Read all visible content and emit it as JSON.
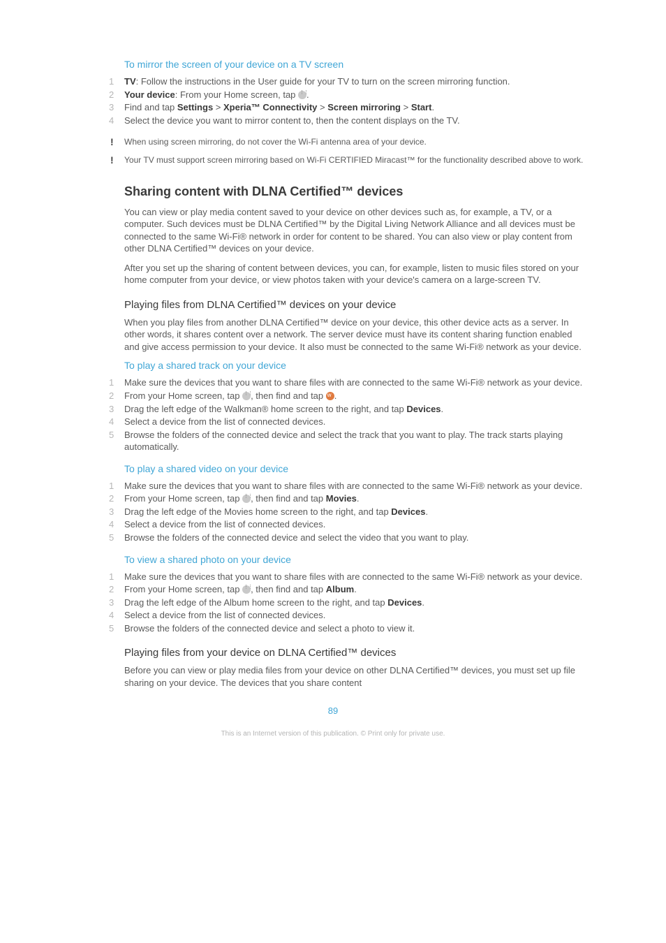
{
  "proc_mirror": {
    "title": "To mirror the screen of your device on a TV screen",
    "steps": {
      "s1": {
        "label": "TV",
        "rest": ": Follow the instructions in the User guide for your TV to turn on the screen mirroring function."
      },
      "s2": {
        "label": "Your device",
        "rest": ": From your Home screen, tap "
      },
      "s3": {
        "pre": "Find and tap ",
        "b1": "Settings",
        "sep1": " > ",
        "b2": "Xperia™ Connectivity",
        "sep2": " > ",
        "b3": "Screen mirroring",
        "sep3": " > ",
        "b4": "Start",
        "end": "."
      },
      "s4": "Select the device you want to mirror content to, then the content displays on the TV."
    },
    "warn1": "When using screen mirroring, do not cover the Wi-Fi antenna area of your device.",
    "warn2": "Your TV must support screen mirroring based on Wi-Fi CERTIFIED Miracast™ for the functionality described above to work."
  },
  "dlna": {
    "heading": "Sharing content with DLNA Certified™ devices",
    "p1": "You can view or play media content saved to your device on other devices such as, for example, a TV, or a computer. Such devices must be DLNA Certified™ by the Digital Living Network Alliance and all devices must be connected to the same Wi-Fi® network in order for content to be shared. You can also view or play content from other DLNA Certified™ devices on your device.",
    "p2": "After you set up the sharing of content between devices, you can, for example, listen to music files stored on your home computer from your device, or view photos taken with your device's camera on a large-screen TV."
  },
  "play_from": {
    "heading": "Playing files from DLNA Certified™ devices on your device",
    "p1": "When you play files from another DLNA Certified™ device on your device, this other device acts as a server. In other words, it shares content over a network. The server device must have its content sharing function enabled and give access permission to your device. It also must be connected to the same Wi-Fi® network as your device."
  },
  "proc_track": {
    "title": "To play a shared track on your device",
    "s1": "Make sure the devices that you want to share files with are connected to the same Wi-Fi® network as your device.",
    "s2": {
      "pre": "From your Home screen, tap ",
      "mid": ", then find and tap ",
      "end": "."
    },
    "s3": {
      "pre": "Drag the left edge of the Walkman® home screen to the right, and tap ",
      "bold": "Devices",
      "end": "."
    },
    "s4": "Select a device from the list of connected devices.",
    "s5": "Browse the folders of the connected device and select the track that you want to play. The track starts playing automatically."
  },
  "proc_video": {
    "title": "To play a shared video on your device",
    "s1": "Make sure the devices that you want to share files with are connected to the same Wi-Fi® network as your device.",
    "s2": {
      "pre": "From your Home screen, tap ",
      "mid": ", then find and tap ",
      "bold": "Movies",
      "end": "."
    },
    "s3": {
      "pre": "Drag the left edge of the Movies home screen to the right, and tap ",
      "bold": "Devices",
      "end": "."
    },
    "s4": "Select a device from the list of connected devices.",
    "s5": "Browse the folders of the connected device and select the video that you want to play."
  },
  "proc_photo": {
    "title": "To view a shared photo on your device",
    "s1": "Make sure the devices that you want to share files with are connected to the same Wi-Fi® network as your device.",
    "s2": {
      "pre": "From your Home screen, tap ",
      "mid": ", then find and tap ",
      "bold": "Album",
      "end": "."
    },
    "s3": {
      "pre": "Drag the left edge of the Album home screen to the right, and tap ",
      "bold": "Devices",
      "end": "."
    },
    "s4": "Select a device from the list of connected devices.",
    "s5": "Browse the folders of the connected device and select a photo to view it."
  },
  "play_on": {
    "heading": "Playing files from your device on DLNA Certified™ devices",
    "p1": "Before you can view or play media files from your device on other DLNA Certified™ devices, you must set up file sharing on your device. The devices that you share content"
  },
  "page_number": "89",
  "footnote": "This is an Internet version of this publication. © Print only for private use."
}
